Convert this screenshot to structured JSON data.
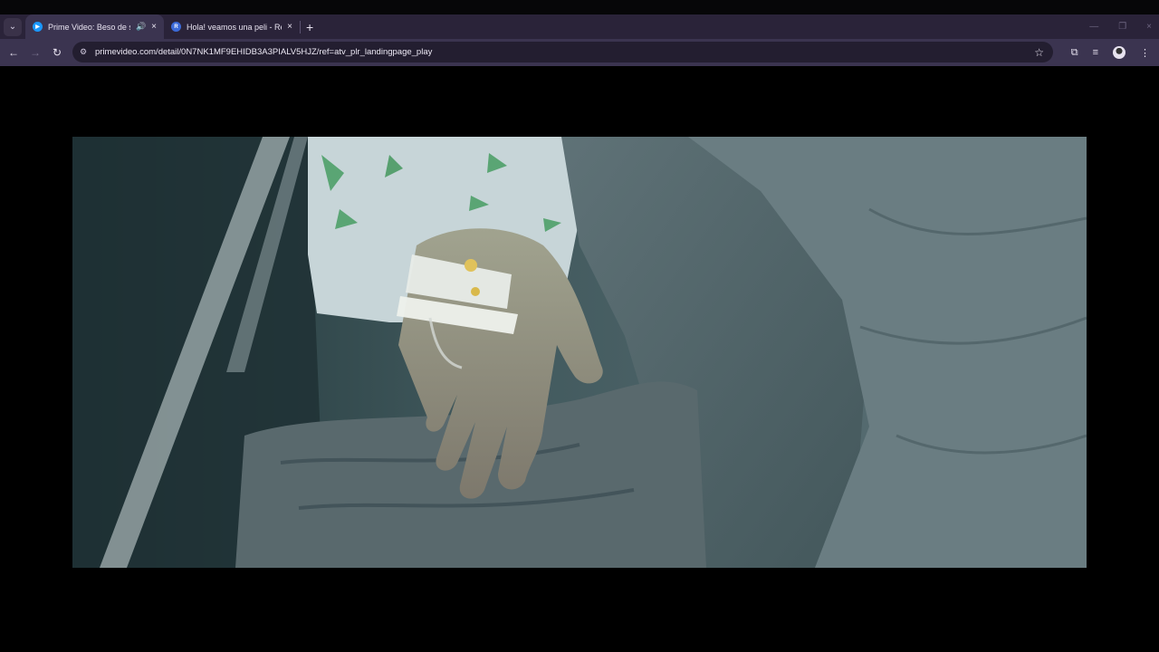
{
  "browser": {
    "tabs": [
      {
        "title": "Prime Video: Beso de sirena",
        "favicon": "prime-video-icon",
        "active": true,
        "audio": true
      },
      {
        "title": "Hola! veamos una peli   - Re",
        "favicon": "r-letter-icon",
        "active": false,
        "audio": false
      }
    ],
    "address_bar": {
      "url": "primevideo.com/detail/0N7NK1MF9EHIDB3A3PIALV5HJZ/ref=atv_plr_landingpage_play"
    },
    "icons": {
      "tab_search": "chevron-down-icon",
      "back": "back-arrow-icon",
      "forward": "forward-arrow-icon",
      "reload": "reload-icon",
      "bookmark": "star-icon",
      "extensions": "puzzle-icon",
      "media": "media-control-icon",
      "profile": "avatar-icon",
      "menu": "kebab-menu-icon"
    },
    "colors": {
      "tab_bar": "#2a2339",
      "toolbar": "#3b3450",
      "omnibox": "#231e30"
    }
  },
  "video": {
    "scene": "hospital-hand-iv-frame"
  }
}
